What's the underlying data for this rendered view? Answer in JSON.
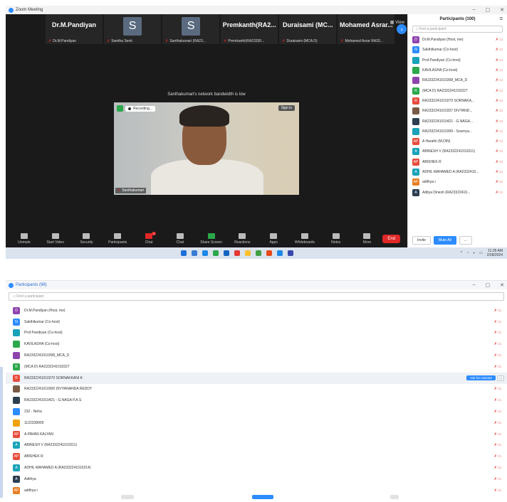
{
  "zoom_window": {
    "title": "Zoom Meeting",
    "view_label": "View",
    "strip": [
      {
        "display": "Dr.M.Pandiyan",
        "sub": "Dr.M.Pandiyan",
        "letter": ""
      },
      {
        "display": "",
        "sub": "Swetha Senti",
        "letter": "S"
      },
      {
        "display": "",
        "sub": "Santhakumari (RA23...",
        "letter": "S"
      },
      {
        "display": "Premkanth(RA2...",
        "sub": "Premkanth(RA23330...",
        "letter": ""
      },
      {
        "display": "Duraisami (MC...",
        "sub": "Duraisami (MCA D)",
        "letter": ""
      },
      {
        "display": "Mohamed Asrar...",
        "sub": "Mohamed Asrar RA33...",
        "letter": ""
      }
    ],
    "bandwidth_notice": "Santhakumari's network bandwidth is low",
    "recording_label": "Recording...",
    "signin_label": "Sign in",
    "video_name": "Santhakumari",
    "toolbar": [
      {
        "label": "Unmute",
        "color": ""
      },
      {
        "label": "Start Video",
        "color": ""
      },
      {
        "label": "Security",
        "color": ""
      },
      {
        "label": "Participants",
        "color": ""
      },
      {
        "label": "Chat",
        "color": "red",
        "badge": "2"
      },
      {
        "label": "Chat",
        "color": ""
      },
      {
        "label": "Share Screen",
        "color": "green"
      },
      {
        "label": "Reactions",
        "color": ""
      },
      {
        "label": "Apps",
        "color": ""
      },
      {
        "label": "Whiteboards",
        "color": ""
      },
      {
        "label": "Notes",
        "color": ""
      },
      {
        "label": "More",
        "color": ""
      }
    ],
    "end_label": "End",
    "taskbar_time": "11:35 AM",
    "taskbar_date": "2/28/2024",
    "taskbar_colors": [
      "#1e6fd9",
      "#3a7bd5",
      "#1e88e5",
      "#2aa84a",
      "#1565c0",
      "#e53935",
      "#fbc02d",
      "#43a047",
      "#e64a19",
      "#1e88e5",
      "#3949ab"
    ]
  },
  "side_panel": {
    "title": "Participants (100)",
    "search_placeholder": "Find a participant",
    "rows": [
      {
        "initial": "D",
        "color": "#8e44ad",
        "name": "Dr.M.Pandiyan (Host, me)"
      },
      {
        "initial": "N",
        "color": "#2d8cff",
        "name": "Sakthikumar (Co-host)"
      },
      {
        "initial": "",
        "color": "#1aa3b8",
        "name": "Prof.Pandiyan (Co-host)"
      },
      {
        "initial": "",
        "color": "#2aa84a",
        "name": "KAVILASHA (Co-host)"
      },
      {
        "initial": "",
        "color": "#8e44ad",
        "name": "RA2332241010398_MCA_D"
      },
      {
        "initial": "R",
        "color": "#2aa84a",
        "name": "(MCA D) RA2332241010327"
      },
      {
        "initial": "R",
        "color": "#e74c3c",
        "name": "RA2332241010270 SORNAKA..."
      },
      {
        "initial": "",
        "color": "#7a5a44",
        "name": "RA2332241010337 DIVYAND..."
      },
      {
        "initial": "",
        "color": "#2c3e50",
        "name": "RA2332241010421 - G.NAGA..."
      },
      {
        "initial": "",
        "color": "#1aa3b8",
        "name": "RA2332241010399 - Soumya..."
      },
      {
        "initial": "AP",
        "color": "#e74c3c",
        "name": "A Harathi (M.DIN)"
      },
      {
        "initial": "A",
        "color": "#1aa3b8",
        "name": "ABINESH V (RA2332241010211)"
      },
      {
        "initial": "AP",
        "color": "#e74c3c",
        "name": "ABISHEK R"
      },
      {
        "initial": "A",
        "color": "#1aa3b8",
        "name": "ADHIL MAHAMED A (RA2332410..."
      },
      {
        "initial": "AP",
        "color": "#e67e22",
        "name": "adithya r"
      },
      {
        "initial": "A",
        "color": "#2c3e50",
        "name": "Aditya Dinesh (RA23322410..."
      }
    ],
    "invite_label": "Invite",
    "mute_all_label": "Mute All",
    "more_label": "..."
  },
  "participants_window": {
    "title": "Participants (98)",
    "search_placeholder": "Find a participant",
    "admit_label": "Ask for Unmute",
    "more_label": "...",
    "rows": [
      {
        "initial": "D",
        "color": "#8e44ad",
        "name": "Dr.M.Pandiyan (Host, me)",
        "highlight": false
      },
      {
        "initial": "N",
        "color": "#2d8cff",
        "name": "Sakthikumar (Co-host)",
        "highlight": false
      },
      {
        "initial": "",
        "color": "#1aa3b8",
        "name": "Prof.Pandiyan (Co-host)",
        "highlight": false
      },
      {
        "initial": "",
        "color": "#2aa84a",
        "name": "KAVILASHA (Co-host)",
        "highlight": false
      },
      {
        "initial": "",
        "color": "#8e44ad",
        "name": "RA2332241010398_MCA_D",
        "highlight": false
      },
      {
        "initial": "R",
        "color": "#2aa84a",
        "name": "(MCA D) RA2332241010327",
        "highlight": false
      },
      {
        "initial": "R",
        "color": "#e74c3c",
        "name": "RA2332241010270 SORNAKKANI K",
        "highlight": true
      },
      {
        "initial": "",
        "color": "#7a5a44",
        "name": "RA2332241010306 DIVYANANDA REDDY",
        "highlight": false
      },
      {
        "initial": "",
        "color": "#2c3e50",
        "name": "RA2332241010421 - G.NAGA P.A.S",
        "highlight": false
      },
      {
        "initial": "",
        "color": "#2d8cff",
        "name": "232 - Neha",
        "highlight": false
      },
      {
        "initial": "",
        "color": "#f1a30c",
        "name": "1122338900",
        "highlight": false
      },
      {
        "initial": "AP",
        "color": "#e74c3c",
        "name": "A.PAVAN KALYAN",
        "highlight": false
      },
      {
        "initial": "A",
        "color": "#1aa3b8",
        "name": "ABINESH V (RA2332241010211)",
        "highlight": false
      },
      {
        "initial": "AP",
        "color": "#e74c3c",
        "name": "ABISHEK R",
        "highlight": false
      },
      {
        "initial": "A",
        "color": "#1aa3b8",
        "name": "ADHIL MAHAMED A (RA2332241010214)",
        "highlight": false
      },
      {
        "initial": "A",
        "color": "#2c3e50",
        "name": "Adithya",
        "highlight": false
      },
      {
        "initial": "AP",
        "color": "#e67e22",
        "name": "adithya r",
        "highlight": false
      }
    ]
  }
}
